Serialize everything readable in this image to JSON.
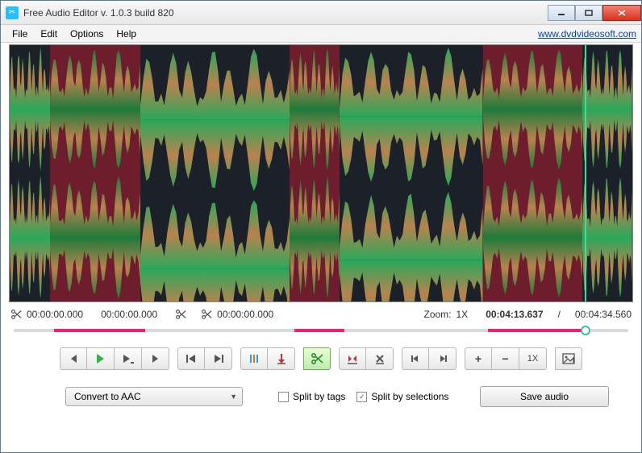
{
  "window": {
    "title": "Free Audio Editor v. 1.0.3 build 820"
  },
  "menu": {
    "file": "File",
    "edit": "Edit",
    "options": "Options",
    "help": "Help",
    "link": "www.dvdvideosoft.com"
  },
  "info": {
    "sel_start": "00:00:00.000",
    "sel_end": "00:00:00.000",
    "cut_time": "00:00:00.000",
    "zoom_label": "Zoom:",
    "zoom_value": "1X",
    "current_time": "00:04:13.637",
    "sep": "/",
    "total_time": "00:04:34.560"
  },
  "toolbar": {
    "zoom_1x": "1X"
  },
  "bottom": {
    "convert_label": "Convert to AAC",
    "split_tags": "Split by tags",
    "split_sel": "Split by selections",
    "save": "Save audio"
  },
  "regions": [
    {
      "start": 0,
      "end": 6.5,
      "selected": false
    },
    {
      "start": 6.5,
      "end": 21,
      "selected": true
    },
    {
      "start": 21,
      "end": 45,
      "selected": false
    },
    {
      "start": 45,
      "end": 53,
      "selected": true
    },
    {
      "start": 53,
      "end": 76,
      "selected": false
    },
    {
      "start": 76,
      "end": 92,
      "selected": true
    },
    {
      "start": 92,
      "end": 100,
      "selected": false
    }
  ],
  "playhead_pct": 92.4
}
